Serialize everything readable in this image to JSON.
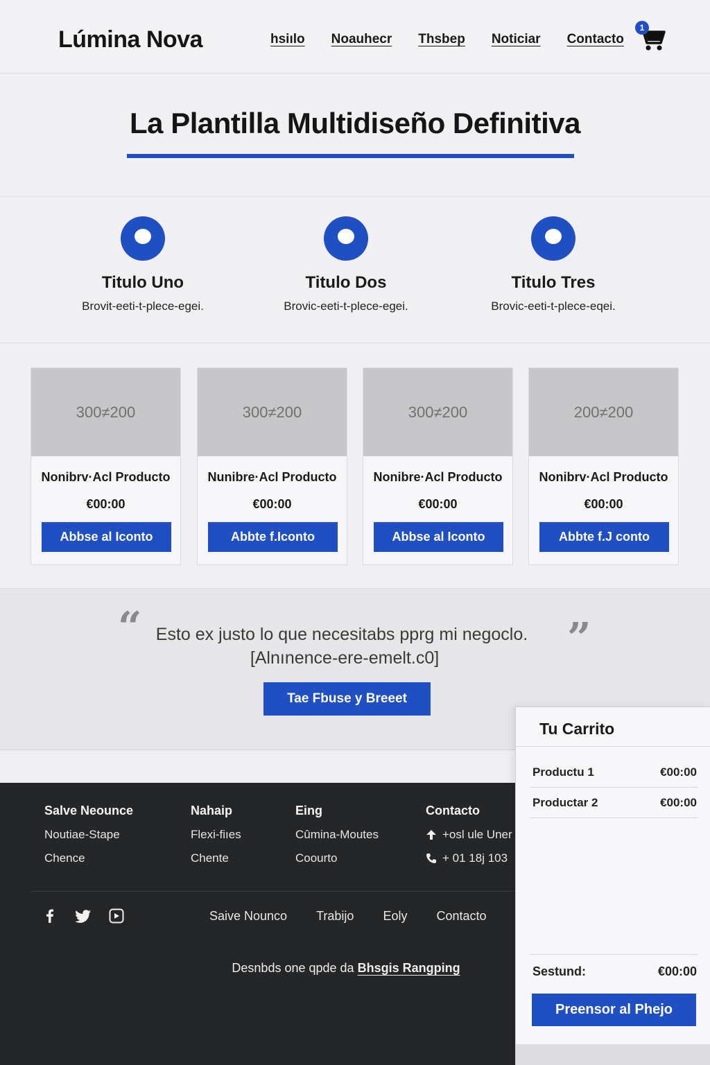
{
  "header": {
    "logo": "Lúmina Nova",
    "nav": [
      "hsiılo",
      "Noauhecr",
      "Thsbep",
      "Noticiar",
      "Contacto"
    ],
    "cart_count": "1",
    "cart_icon": "shopping-cart-icon"
  },
  "hero": {
    "title": "La Plantilla Multidiseño Definitiva"
  },
  "features": [
    {
      "title": "Titulo Uno",
      "text": "Brovit-eeti-t-plece-egei."
    },
    {
      "title": "Titulo Dos",
      "text": "Brovic-eeti-t-plece-egei."
    },
    {
      "title": "Titulo Tres",
      "text": "Brovic-eeti-t-plece-eqei."
    }
  ],
  "products": [
    {
      "image_label": "300≠200",
      "name": "Nonibrv·Acl Producto",
      "price": "€00:00",
      "button": "Abbse al Iconto"
    },
    {
      "image_label": "300≠200",
      "name": "Nunibre·Acl Producto",
      "price": "€00:00",
      "button": "Abbte f.Iconto"
    },
    {
      "image_label": "300≠200",
      "name": "Nonibre·Acl Producto",
      "price": "€00:00",
      "button": "Abbse al Iconto"
    },
    {
      "image_label": "200≠200",
      "name": "Nonibrv·Acl Producto",
      "price": "€00:00",
      "button": "Abbte f.J conto"
    }
  ],
  "testimonial": {
    "quote": "Esto ex justo lo que necesitabs pprg mi negoclo.",
    "author": "[Alnınence-ere-emelt.c0]",
    "button": "Tae Fbuse y Breeet"
  },
  "footer": {
    "columns": [
      {
        "title": "Salve Neounce",
        "links": [
          "Noutiae-Stape",
          "Chence"
        ]
      },
      {
        "title": "Nahaip",
        "links": [
          "Flexi-fiıes",
          "Chente"
        ]
      },
      {
        "title": "Eing",
        "links": [
          "Cûmina-Moutes",
          "Coourto"
        ]
      }
    ],
    "contact": {
      "title": "Contacto",
      "address": "+osl ule Uner",
      "phone": "+ 01 18j 103"
    },
    "nav": [
      "Saive Nounco",
      "Trabijo",
      "Eoly",
      "Contacto"
    ],
    "credit_prefix": "Desnbds one qpde da",
    "credit_link": "Bhsgis Rangping"
  },
  "cart": {
    "title": "Tu Carrito",
    "items": [
      {
        "name": "Productu 1",
        "price": "€00:00"
      },
      {
        "name": "Productar 2",
        "price": "€00:00"
      }
    ],
    "subtotal_label": "Sestund:",
    "subtotal_value": "€00:00",
    "checkout": "Preensor al Phejo"
  },
  "colors": {
    "accent": "#1f4fc2",
    "footer_bg": "#252628",
    "page_bg": "#efeff1"
  }
}
